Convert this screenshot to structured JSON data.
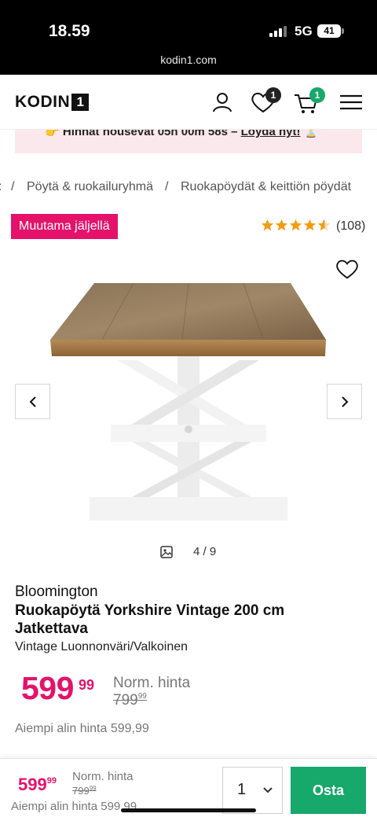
{
  "status_bar": {
    "time": "18.59",
    "network": "5G",
    "battery": "41",
    "url": "kodin1.com"
  },
  "header": {
    "logo_text": "KODIN",
    "logo_mark": "1",
    "icons": [
      "account-icon",
      "heart-icon",
      "cart-icon",
      "menu-icon"
    ],
    "wishlist_count": "1",
    "cart_count": "1",
    "colors": {
      "wishlist_badge": "#222222",
      "cart_badge": "#17a86b"
    }
  },
  "promo": {
    "emoji_left": "👉",
    "text": "Hinnat nousevat 05h 00m 58s – ",
    "link": "Löydä nyt!",
    "emoji_right": "⏳"
  },
  "breadcrumb": {
    "items": [
      ":",
      "/",
      "Pöytä & ruokailuryhmä",
      "/",
      "Ruokapöydät & keittiön pöydät"
    ]
  },
  "stock_badge": "Muutama jäljellä",
  "rating": {
    "stars": 4.5,
    "max": 5,
    "count": "(108)"
  },
  "gallery": {
    "counter": "4 / 9",
    "current": 4,
    "total": 9
  },
  "product": {
    "brand": "Bloomington",
    "title": "Ruokapöytä Yorkshire Vintage 200 cm Jatkettava",
    "variant": "Vintage Luonnonväri/Valkoinen"
  },
  "price": {
    "integer": "599",
    "decimals": "99",
    "normal_label": "Norm. hinta",
    "normal_integer": "799",
    "normal_decimals": "99",
    "previous_lowest": "Aiempi alin hinta 599,99"
  },
  "sticky_bar": {
    "price_integer": "599",
    "price_decimals": "99",
    "normal_label": "Norm. hinta",
    "normal_integer": "799",
    "normal_decimals": "99",
    "previous_lowest": "Aiempi alin hinta 599,99",
    "quantity": "1",
    "buy_label": "Osta"
  },
  "colors": {
    "accent": "#e4126b",
    "buy": "#17a86b",
    "star": "#f39c12",
    "promo_bg": "#fbe8ec"
  }
}
